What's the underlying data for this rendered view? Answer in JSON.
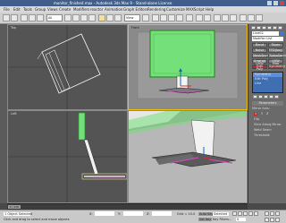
{
  "window": {
    "title": "monitor_finished.max - Autodesk 3ds Max 9 - Stand-alone License"
  },
  "menu": [
    "File",
    "Edit",
    "Tools",
    "Group",
    "Views",
    "Create",
    "Modifiers",
    "reactor",
    "Animation",
    "Graph Editors",
    "Rendering",
    "Customize",
    "MAXScript",
    "Help"
  ],
  "toolbar": {
    "selection_filter": "All",
    "view_dropdown": "View"
  },
  "viewports": {
    "top": {
      "label": "Top"
    },
    "front": {
      "label": "Front"
    },
    "left": {
      "label": "Left"
    },
    "perspective": {
      "label": "Perspective"
    }
  },
  "command_panel": {
    "object_name": "Line02",
    "modifier_list": "Modifier List",
    "buttons": [
      "Bend",
      "Taper",
      "Noise",
      "FFD(box)",
      "MeshSmooth",
      "TurboSmooth",
      "Unwrap UVW",
      "UVW Map",
      "Edit Poly",
      "Symmetry"
    ],
    "stack_items": [
      "Symmetry",
      "Edit Poly",
      "Line"
    ],
    "section_label": "Parameters",
    "options": [
      "Mirror Axis:",
      "X",
      "Y",
      "Z",
      "Flip",
      "Slice Along Mirror",
      "Weld Seam",
      "Threshold:"
    ]
  },
  "timebar": {
    "frame": "0 / 100"
  },
  "status": {
    "selected": "1 Object Selected",
    "prompt": "Click and drag to select and move objects",
    "x_label": "X:",
    "x_value": "",
    "y_label": "Y:",
    "z_label": "Z:",
    "grid": "Grid = 10.0",
    "auto_key": "Auto Key",
    "set_key": "Set Key",
    "key_filters": "Key Filters...",
    "frame": "0",
    "selected_dropdown": "Selected"
  },
  "colors": {
    "accent": "#c0262b",
    "selection": "#f0c000",
    "screen_green": "#74e07a",
    "highlight_magenta": "#c84bb8"
  }
}
